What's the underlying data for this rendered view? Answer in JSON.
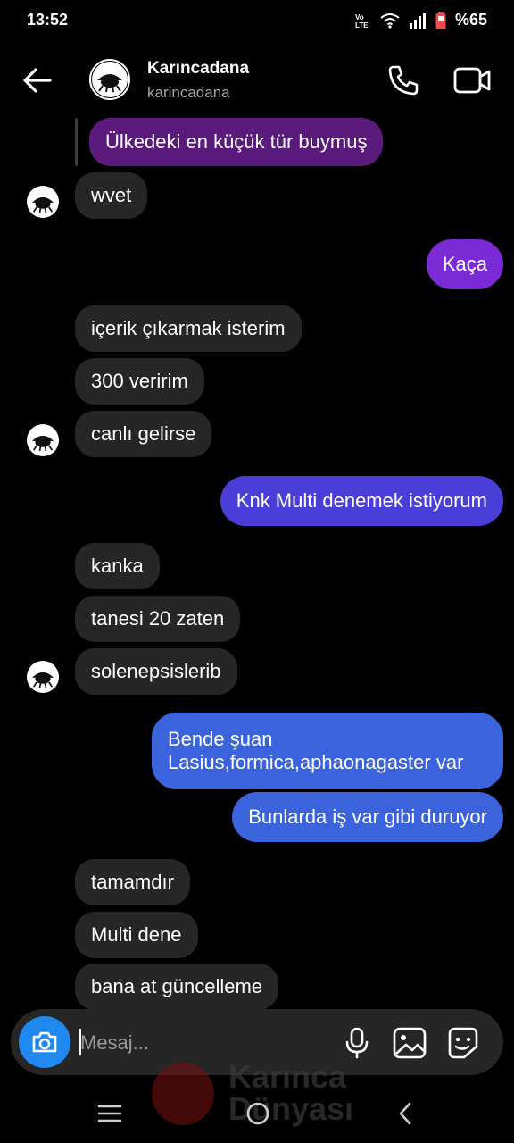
{
  "status_bar": {
    "time": "13:52",
    "network": "Vo))\nLTE",
    "battery": "%65"
  },
  "header": {
    "name": "Karıncadana",
    "username": "karincadana"
  },
  "messages": {
    "reply_quote": "Ülkedeki en küçük tür buymuş",
    "m1": "wvet",
    "m2": "Kaça",
    "m3": "içerik çıkarmak isterim",
    "m4": "300 veririm",
    "m5": "canlı gelirse",
    "m6": "Knk Multi denemek istiyorum",
    "m7": "kanka",
    "m8": "tanesi 20 zaten",
    "m9": "solenepsislerib",
    "m10_line1": "Bende şuan",
    "m10_line2": "Lasius,formica,aphaonagaster var",
    "m11": "Bunlarda iş var gibi duruyor",
    "m12": "tamamdır",
    "m13": "Multi dene",
    "m14": "bana at güncelleme"
  },
  "composer": {
    "placeholder": "Mesaj..."
  },
  "watermark": {
    "line1": "Karınca",
    "line2": "Dünyası"
  },
  "colors": {
    "incoming": "#262626",
    "outgoing_purple": "#7a2bd6",
    "outgoing_indigo": "#4a3ed8",
    "outgoing_blue": "#3a63dc",
    "camera": "#1f89f0"
  }
}
